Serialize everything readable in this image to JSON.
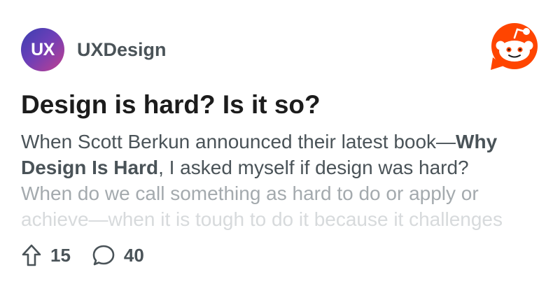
{
  "community": {
    "avatar_text": "UX",
    "name": "UXDesign"
  },
  "brand": {
    "logo_icon": "reddit-snoo-icon",
    "accent_color": "#ff4500"
  },
  "post": {
    "title": "Design is hard? Is it so?",
    "body_lines": [
      "When Scott Berkun announced their latest book—",
      "Why",
      "Design Is Hard",
      ", I asked myself if design was hard?",
      "When do we call something as hard to do or apply or",
      "achieve—when it is tough to do it because it challenges"
    ]
  },
  "stats": {
    "upvote_icon": "upvote-arrow-icon",
    "upvotes": "15",
    "comment_icon": "comment-bubble-icon",
    "comments": "40"
  }
}
